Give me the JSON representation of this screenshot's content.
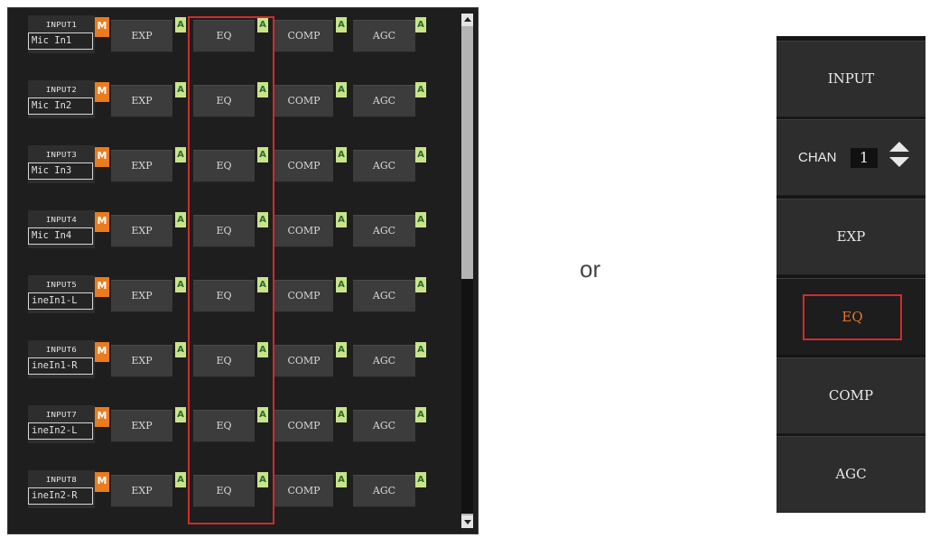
{
  "channels": [
    {
      "label": "INPUT1",
      "name": "Mic In1",
      "mute": "M",
      "modules": [
        "EXP",
        "EQ",
        "COMP",
        "AGC"
      ],
      "auto": "A"
    },
    {
      "label": "INPUT2",
      "name": "Mic In2",
      "mute": "M",
      "modules": [
        "EXP",
        "EQ",
        "COMP",
        "AGC"
      ],
      "auto": "A"
    },
    {
      "label": "INPUT3",
      "name": "Mic In3",
      "mute": "M",
      "modules": [
        "EXP",
        "EQ",
        "COMP",
        "AGC"
      ],
      "auto": "A"
    },
    {
      "label": "INPUT4",
      "name": "Mic In4",
      "mute": "M",
      "modules": [
        "EXP",
        "EQ",
        "COMP",
        "AGC"
      ],
      "auto": "A"
    },
    {
      "label": "INPUT5",
      "name": "ineIn1-L",
      "mute": "M",
      "modules": [
        "EXP",
        "EQ",
        "COMP",
        "AGC"
      ],
      "auto": "A"
    },
    {
      "label": "INPUT6",
      "name": "ineIn1-R",
      "mute": "M",
      "modules": [
        "EXP",
        "EQ",
        "COMP",
        "AGC"
      ],
      "auto": "A"
    },
    {
      "label": "INPUT7",
      "name": "ineIn2-L",
      "mute": "M",
      "modules": [
        "EXP",
        "EQ",
        "COMP",
        "AGC"
      ],
      "auto": "A"
    },
    {
      "label": "INPUT8",
      "name": "ineIn2-R",
      "mute": "M",
      "modules": [
        "EXP",
        "EQ",
        "COMP",
        "AGC"
      ],
      "auto": "A"
    }
  ],
  "separator_text": "or",
  "right_panel": {
    "input_label": "INPUT",
    "chan_label": "CHAN",
    "chan_value": "1",
    "exp_label": "EXP",
    "eq_label": "EQ",
    "comp_label": "COMP",
    "agc_label": "AGC"
  },
  "colors": {
    "highlight": "#d42a2a",
    "mute": "#ea7c1e",
    "auto_tag": "#c9e48a",
    "eq_text_active": "#e8752a"
  },
  "icons": {
    "scroll_up": "triangle-up-icon",
    "scroll_down": "triangle-down-icon",
    "chan_up": "chevron-up-icon",
    "chan_down": "chevron-down-icon"
  }
}
